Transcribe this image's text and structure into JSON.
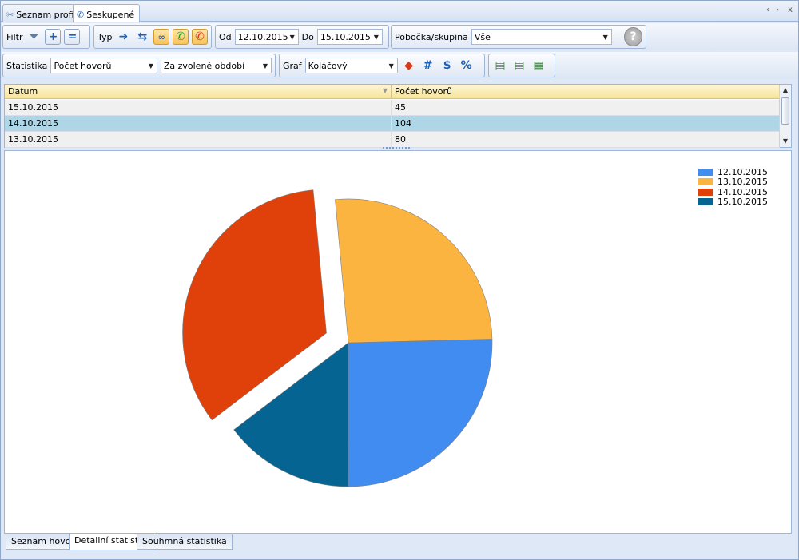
{
  "doc_tabs": [
    "Seznam profilů",
    "Seskupené"
  ],
  "window_controls": [
    "‹",
    "›",
    "x"
  ],
  "filter": {
    "label": "Filtr",
    "plus": "+",
    "equals": "="
  },
  "typ": {
    "label": "Typ"
  },
  "date": {
    "from_label": "Od",
    "from_value": "12.10.2015",
    "to_label": "Do",
    "to_value": "15.10.2015"
  },
  "branch": {
    "label": "Pobočka/skupina",
    "value": "Vše",
    "help": "?"
  },
  "statistika": {
    "label": "Statistika",
    "value": "Počet hovorů",
    "period": "Za zvolené období"
  },
  "graf": {
    "label": "Graf",
    "value": "Koláčový",
    "hash": "#",
    "dollar": "$",
    "percent": "%"
  },
  "grid": {
    "columns": [
      "Datum",
      "Počet hovorů"
    ],
    "rows": [
      [
        "15.10.2015",
        "45"
      ],
      [
        "14.10.2015",
        "104"
      ],
      [
        "13.10.2015",
        "80"
      ]
    ],
    "selected_row": 1
  },
  "chart_data": {
    "type": "pie",
    "labels": [
      "12.10.2015",
      "13.10.2015",
      "14.10.2015",
      "15.10.2015"
    ],
    "values": [
      78,
      80,
      104,
      45
    ],
    "colors": [
      "#418cf0",
      "#fcb441",
      "#e0400a",
      "#056492"
    ],
    "exploded": "14.10.2015",
    "legend": "top-right"
  },
  "bottom_tabs": [
    "Seznam hovorů",
    "Detailní statistika",
    "Souhmná statistika"
  ],
  "active_bottom_tab": 1
}
